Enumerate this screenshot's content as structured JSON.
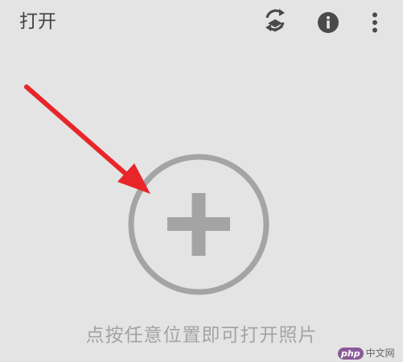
{
  "appbar": {
    "title": "打开",
    "actions": [
      {
        "icon": "restore-layers-icon"
      },
      {
        "icon": "info-icon"
      },
      {
        "icon": "more-vertical-icon"
      }
    ]
  },
  "main": {
    "add_icon": "plus-circle-icon",
    "hint": "点按任意位置即可打开照片"
  },
  "annotation": {
    "arrow_color": "#e8262a"
  },
  "watermark": {
    "logo_text": "php",
    "site_text": "中文网"
  },
  "colors": {
    "background": "#e4e4e4",
    "icon": "#4a4a4a",
    "plus_gray": "#a4a4a4",
    "hint_text": "#a3a3a3"
  }
}
